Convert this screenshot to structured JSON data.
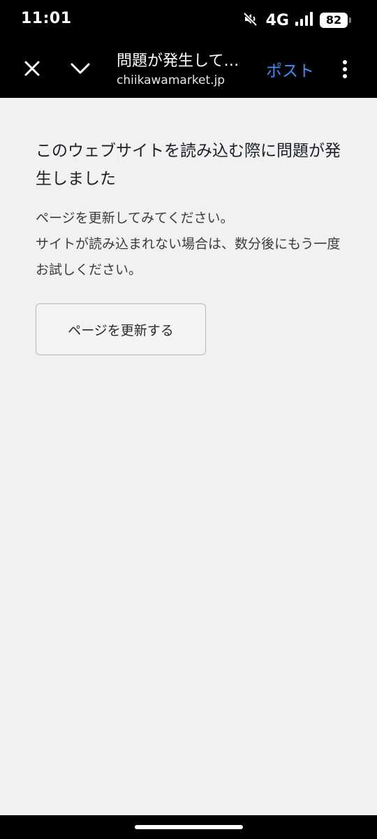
{
  "status_bar": {
    "time": "11:01",
    "network": "4G",
    "battery": "82",
    "icons": [
      "mute-icon",
      "signal-icon",
      "battery-icon"
    ]
  },
  "toolbar": {
    "title": "問題が発生して…",
    "domain": "chiikawamarket.jp",
    "post_label": "ポスト",
    "icons": [
      "close-icon",
      "chevron-down-icon",
      "more-vert-icon"
    ],
    "accent_color": "#3d8ff5"
  },
  "error_page": {
    "heading": "このウェブサイトを読み込む際に問題が発生しました",
    "message_line1": "ページを更新してみてください。",
    "message_line2": "サイトが読み込まれない場合は、数分後にもう一度お試しください。",
    "reload_label": "ページを更新する"
  }
}
